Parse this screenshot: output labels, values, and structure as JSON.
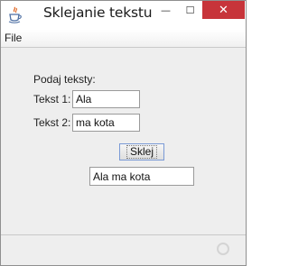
{
  "window": {
    "title": "Sklejanie tekstu",
    "minimize_glyph": "—",
    "maximize_glyph": "☐",
    "close_glyph": "✕",
    "icon": "java-coffee-cup-icon",
    "colors": {
      "close_button_bg": "#c7343a",
      "client_bg": "#eeeeee",
      "title_bar_bg": "#ffffff"
    }
  },
  "menubar": {
    "items": [
      {
        "label": "File"
      }
    ]
  },
  "form": {
    "prompt_label": "Podaj teksty:",
    "text1_label": "Tekst 1:",
    "text1_value": "Ala",
    "text2_label": "Tekst 2:",
    "text2_value": "ma kota",
    "join_button_label": "Sklej",
    "result_value": "Ala ma kota"
  },
  "statusbar": {
    "indicator": "busy-spinner-icon"
  }
}
